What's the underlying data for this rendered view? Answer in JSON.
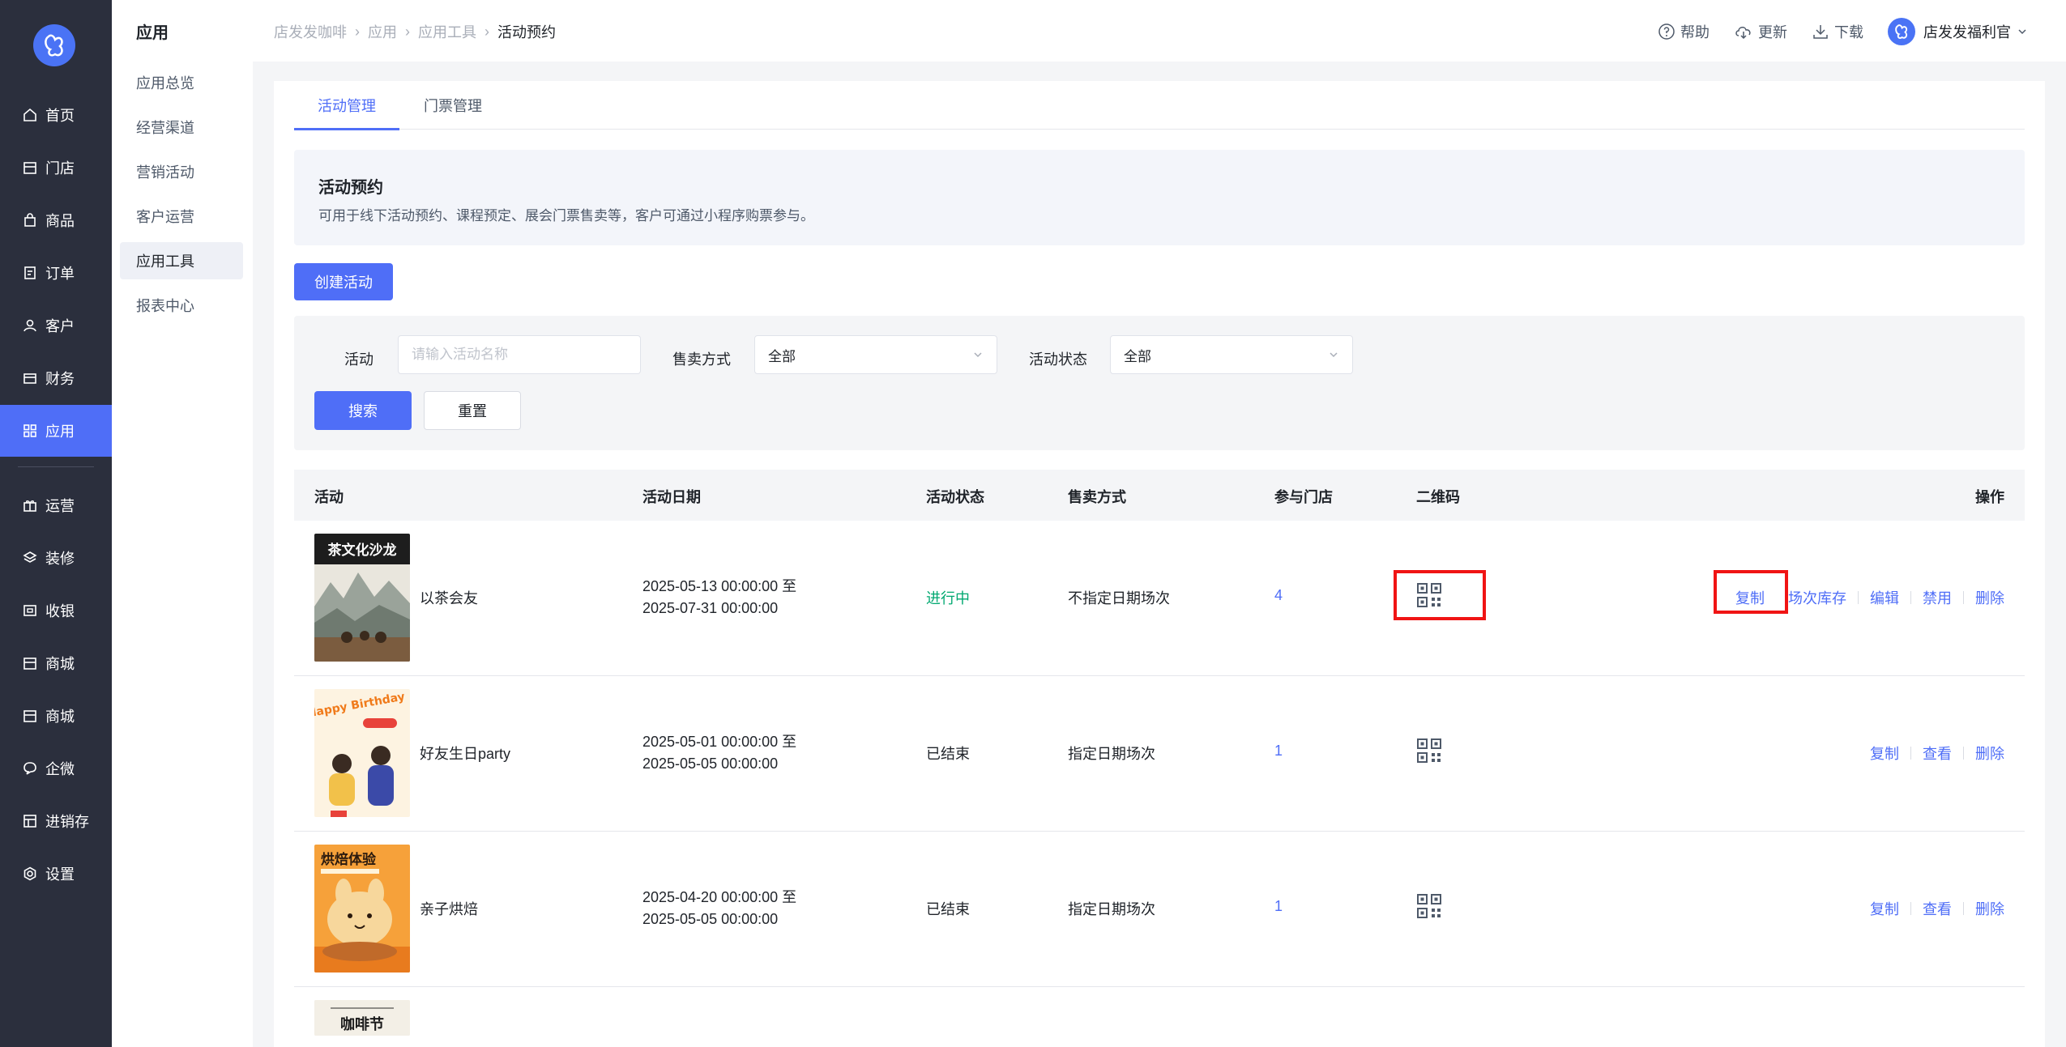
{
  "sidebar": {
    "items": [
      {
        "label": "首页",
        "icon": "home-icon"
      },
      {
        "label": "门店",
        "icon": "store-icon"
      },
      {
        "label": "商品",
        "icon": "bag-icon"
      },
      {
        "label": "订单",
        "icon": "order-icon"
      },
      {
        "label": "客户",
        "icon": "user-icon"
      },
      {
        "label": "财务",
        "icon": "wallet-icon"
      },
      {
        "label": "应用",
        "icon": "apps-icon",
        "active": true
      },
      {
        "label": "运营",
        "icon": "gift-icon"
      },
      {
        "label": "装修",
        "icon": "layers-icon"
      },
      {
        "label": "收银",
        "icon": "cashier-icon"
      },
      {
        "label": "商城",
        "icon": "mall-icon"
      },
      {
        "label": "商城",
        "icon": "mall-icon"
      },
      {
        "label": "企微",
        "icon": "chat-icon"
      },
      {
        "label": "进销存",
        "icon": "inventory-icon"
      },
      {
        "label": "设置",
        "icon": "settings-icon"
      }
    ]
  },
  "subnav": {
    "title": "应用",
    "items": [
      "应用总览",
      "经营渠道",
      "营销活动",
      "客户运营",
      "应用工具",
      "报表中心"
    ],
    "active_index": 4
  },
  "breadcrumb": [
    "店发发咖啡",
    "应用",
    "应用工具",
    "活动预约"
  ],
  "topbar": {
    "help": "帮助",
    "update": "更新",
    "download": "下载",
    "user": "店发发福利官"
  },
  "tabs": [
    "活动管理",
    "门票管理"
  ],
  "intro": {
    "title": "活动预约",
    "desc": "可用于线下活动预约、课程预定、展会门票售卖等，客户可通过小程序购票参与。"
  },
  "create_button": "创建活动",
  "filter": {
    "activity_label": "活动",
    "activity_placeholder": "请输入活动名称",
    "sale_label": "售卖方式",
    "sale_value": "全部",
    "status_label": "活动状态",
    "status_value": "全部",
    "search": "搜索",
    "reset": "重置"
  },
  "table": {
    "columns": [
      "活动",
      "活动日期",
      "活动状态",
      "售卖方式",
      "参与门店",
      "二维码",
      "操作"
    ],
    "rows": [
      {
        "name": "以茶会友",
        "date_start": "2025-05-13 00:00:00 至",
        "date_end": "2025-07-31 00:00:00",
        "status": "进行中",
        "sale": "不指定日期场次",
        "stores": "4",
        "ops": [
          "复制",
          "场次库存",
          "编辑",
          "禁用",
          "删除"
        ],
        "poster_text": "茶文化沙龙"
      },
      {
        "name": "好友生日party",
        "date_start": "2025-05-01 00:00:00 至",
        "date_end": "2025-05-05 00:00:00",
        "status": "已结束",
        "sale": "指定日期场次",
        "stores": "1",
        "ops": [
          "复制",
          "查看",
          "删除"
        ],
        "poster_text": "Happy Birthday"
      },
      {
        "name": "亲子烘焙",
        "date_start": "2025-04-20 00:00:00 至",
        "date_end": "2025-05-05 00:00:00",
        "status": "已结束",
        "sale": "指定日期场次",
        "stores": "1",
        "ops": [
          "复制",
          "查看",
          "删除"
        ],
        "poster_text": "烘焙体验"
      }
    ],
    "partial_row_poster_text": "咖啡节"
  },
  "colors": {
    "primary": "#4f6ef7",
    "sidebar_bg": "#2b2f3d",
    "status_live": "#00a870",
    "highlight": "#f01414"
  }
}
